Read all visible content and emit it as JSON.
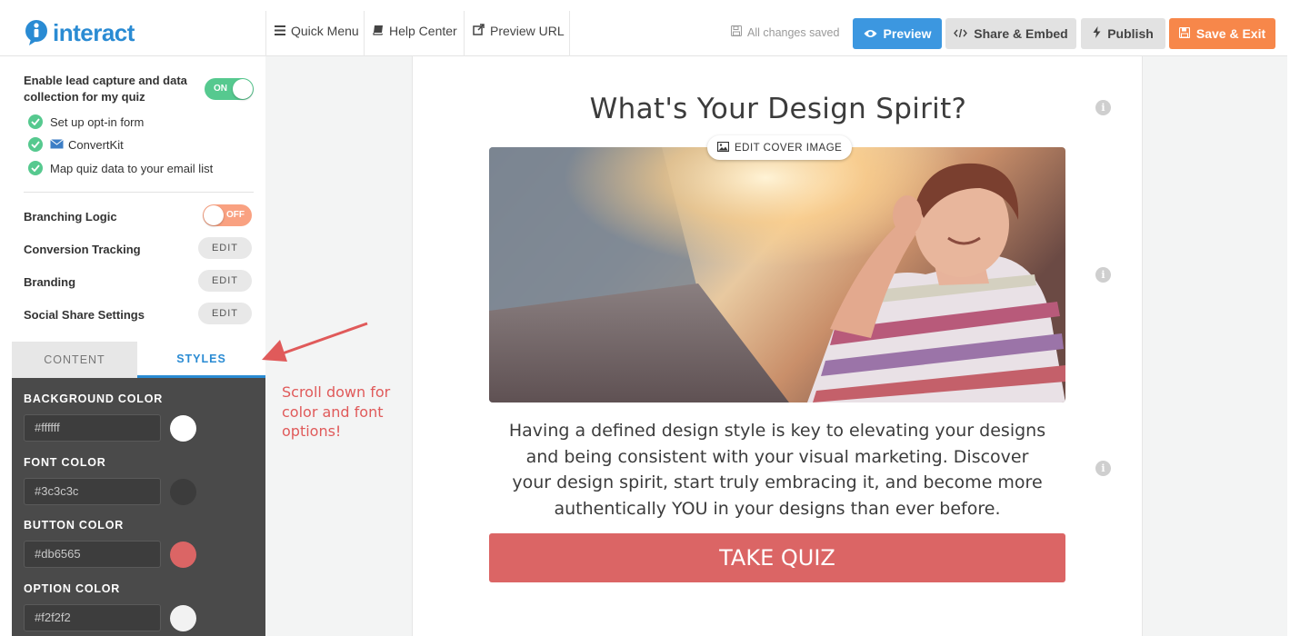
{
  "app": {
    "logo_text": "interact",
    "brand_color": "#2a8bd3"
  },
  "topbar": {
    "quick_menu": "Quick Menu",
    "help_center": "Help Center",
    "preview_url": "Preview URL",
    "saved_status": "All changes saved",
    "preview_btn": "Preview",
    "share_btn": "Share & Embed",
    "publish_btn": "Publish",
    "save_btn": "Save & Exit"
  },
  "sidebar": {
    "lead_capture_label": "Enable lead capture and data collection for my quiz",
    "lead_toggle": "ON",
    "checklist": [
      "Set up opt-in form",
      "ConvertKit",
      "Map quiz data to your email list"
    ],
    "branching_label": "Branching Logic",
    "branching_toggle": "OFF",
    "settings": [
      {
        "label": "Conversion Tracking",
        "button": "EDIT"
      },
      {
        "label": "Branding",
        "button": "EDIT"
      },
      {
        "label": "Social Share Settings",
        "button": "EDIT"
      }
    ],
    "tabs": {
      "content": "CONTENT",
      "styles": "STYLES"
    },
    "styles": [
      {
        "label": "BACKGROUND COLOR",
        "value": "#ffffff",
        "color": "#ffffff"
      },
      {
        "label": "FONT COLOR",
        "value": "#3c3c3c",
        "color": "#3c3c3c"
      },
      {
        "label": "BUTTON COLOR",
        "value": "#db6565",
        "color": "#db6565"
      },
      {
        "label": "OPTION COLOR",
        "value": "#f2f2f2",
        "color": "#f2f2f2"
      }
    ]
  },
  "quiz": {
    "title": "What's Your Design Spirit?",
    "edit_cover": "EDIT COVER IMAGE",
    "description": "Having a defined design style is key to elevating your designs and being consistent with your visual marketing. Discover your design spirit, start truly embracing it, and become more authentically YOU in your designs than ever before.",
    "cta": "TAKE QUIZ",
    "info_icon": "i"
  },
  "annotation": {
    "text": "Scroll down for color and font options!",
    "color": "#e05a5a"
  }
}
